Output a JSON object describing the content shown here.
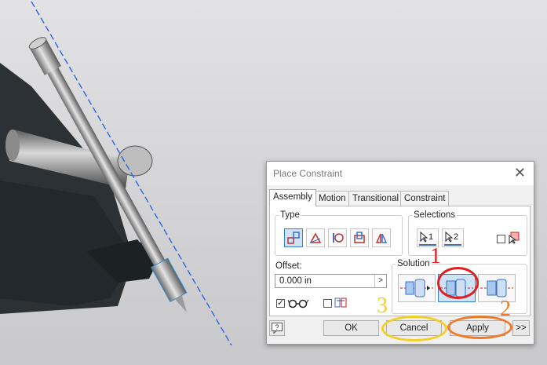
{
  "dialog": {
    "title": "Place Constraint",
    "close_glyph": "✕",
    "tabs": [
      {
        "label": "Assembly",
        "active": true
      },
      {
        "label": "Motion",
        "active": false
      },
      {
        "label": "Transitional",
        "active": false
      },
      {
        "label": "Constraint Set",
        "active": false
      }
    ],
    "type_section": {
      "label": "Type",
      "buttons": [
        "mate-icon",
        "angle-icon",
        "tangent-icon",
        "insert-icon",
        "symmetry-icon"
      ],
      "selected": "mate-icon"
    },
    "selections_section": {
      "label": "Selections",
      "sel1_label": "1",
      "sel2_label": "2",
      "pick_part_first_checked": false
    },
    "offset": {
      "label": "Offset:",
      "value": "0.000 in",
      "arrow": ">"
    },
    "preview_checked": true,
    "predict_offset_checked": false,
    "solution_section": {
      "label": "Solution",
      "options": [
        "mate-solution-icon",
        "flush-solution-icon",
        "undirected-solution-icon"
      ],
      "selected": "flush-solution-icon"
    },
    "buttons": {
      "ok": "OK",
      "cancel": "Cancel",
      "apply": "Apply",
      "expand": ">>",
      "help": "?"
    }
  },
  "annotations": [
    {
      "text": "1",
      "color": "#e02020"
    },
    {
      "text": "2",
      "color": "#f07a2a"
    },
    {
      "text": "3",
      "color": "#f2d02a"
    }
  ],
  "colors": {
    "accent_blue": "#3a7ccc",
    "selected_bg": "#cfe3f7",
    "annotation_red": "#e02020",
    "annotation_orange": "#f07a2a",
    "annotation_yellow": "#f2d02a"
  }
}
